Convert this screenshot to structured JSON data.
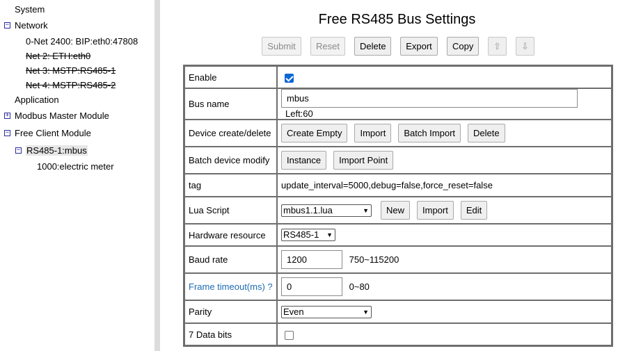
{
  "sidebar": {
    "system": "System",
    "network": "Network",
    "net_items": [
      "0-Net 2400: BIP:eth0:47808",
      "Net 2: ETH:eth0",
      "Net 3: MSTP:RS485-1",
      "Net 4: MSTP:RS485-2"
    ],
    "application": "Application",
    "modbus_master": "Modbus Master Module",
    "free_client": "Free Client Module",
    "bus": "RS485-1:mbus",
    "device": "1000:electric meter",
    "collapse_glyph": "−",
    "expand_glyph": "+"
  },
  "main": {
    "title": "Free RS485 Bus Settings",
    "toolbar": {
      "submit": "Submit",
      "reset": "Reset",
      "delete": "Delete",
      "export": "Export",
      "copy": "Copy",
      "up_arrow": "⇧",
      "down_arrow": "⇩"
    },
    "rows": {
      "enable": {
        "label": "Enable",
        "checked": true
      },
      "bus_name": {
        "label": "Bus name",
        "value": "mbus",
        "left_text": "Left:60"
      },
      "device_create": {
        "label": "Device create/delete",
        "buttons": [
          "Create Empty",
          "Import",
          "Batch Import",
          "Delete"
        ]
      },
      "batch_modify": {
        "label": "Batch device modify",
        "buttons": [
          "Instance",
          "Import Point"
        ]
      },
      "tag": {
        "label": "tag",
        "value": "update_interval=5000,debug=false,force_reset=false"
      },
      "lua": {
        "label": "Lua Script",
        "selected": "mbus1.1.lua",
        "buttons": [
          "New",
          "Import",
          "Edit"
        ]
      },
      "hardware": {
        "label": "Hardware resource",
        "selected": "RS485-1"
      },
      "baud": {
        "label": "Baud rate",
        "value": "1200",
        "hint": "750~115200"
      },
      "frame_timeout": {
        "label": "Frame timeout(ms) ?",
        "value": "0",
        "hint": "0~80"
      },
      "parity": {
        "label": "Parity",
        "selected": "Even"
      },
      "data_bits": {
        "label": "7 Data bits",
        "checked": false
      }
    }
  }
}
